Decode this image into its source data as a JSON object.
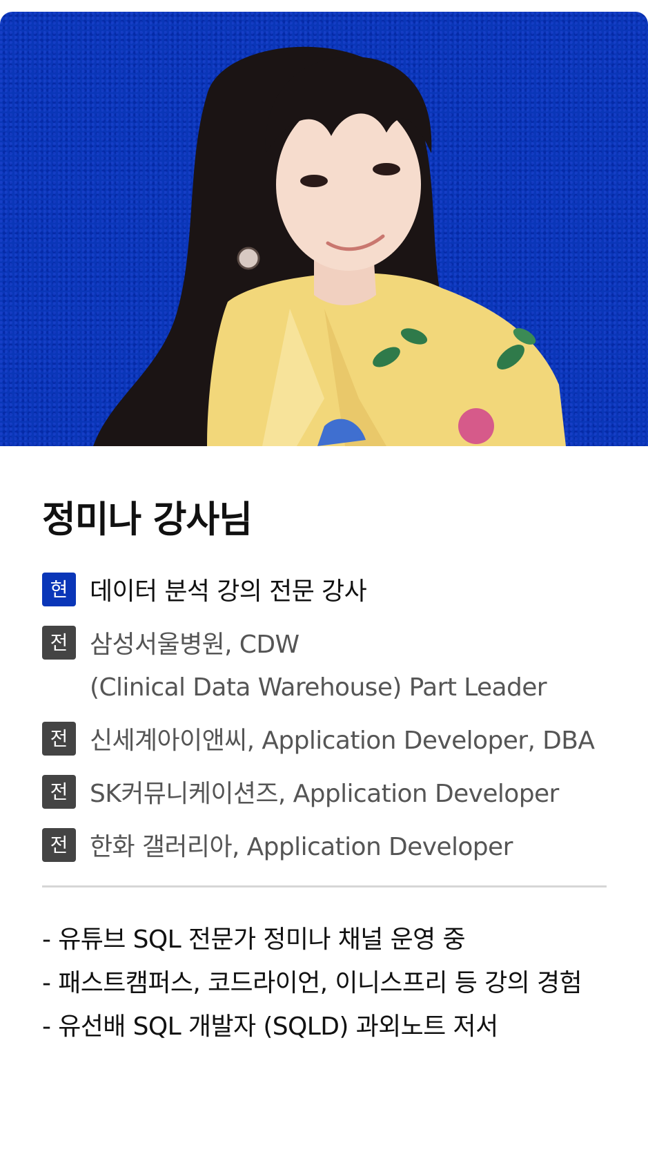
{
  "colors": {
    "hero_background": "#0a36b8",
    "badge_current": "#0a36b8",
    "badge_former": "#444444",
    "text_primary": "#111111",
    "text_secondary": "#555555",
    "divider": "#d6d6d6"
  },
  "profile": {
    "photo_alt": "instructor-portrait",
    "name": "정미나 강사님"
  },
  "careers": [
    {
      "badge": "현",
      "status": "current",
      "lines": [
        "데이터 분석 강의 전문 강사"
      ]
    },
    {
      "badge": "전",
      "status": "former",
      "lines": [
        "삼성서울병원, CDW",
        "(Clinical Data Warehouse) Part Leader"
      ]
    },
    {
      "badge": "전",
      "status": "former",
      "lines": [
        "신세계아이앤씨, Application Developer, DBA"
      ]
    },
    {
      "badge": "전",
      "status": "former",
      "lines": [
        "SK커뮤니케이션즈, Application Developer"
      ]
    },
    {
      "badge": "전",
      "status": "former",
      "lines": [
        "한화 갤러리아, Application Developer"
      ]
    }
  ],
  "notes": [
    "- 유튜브 SQL 전문가 정미나 채널 운영 중",
    "- 패스트캠퍼스, 코드라이언, 이니스프리 등 강의 경험",
    "- 유선배 SQL 개발자 (SQLD) 과외노트 저서"
  ]
}
